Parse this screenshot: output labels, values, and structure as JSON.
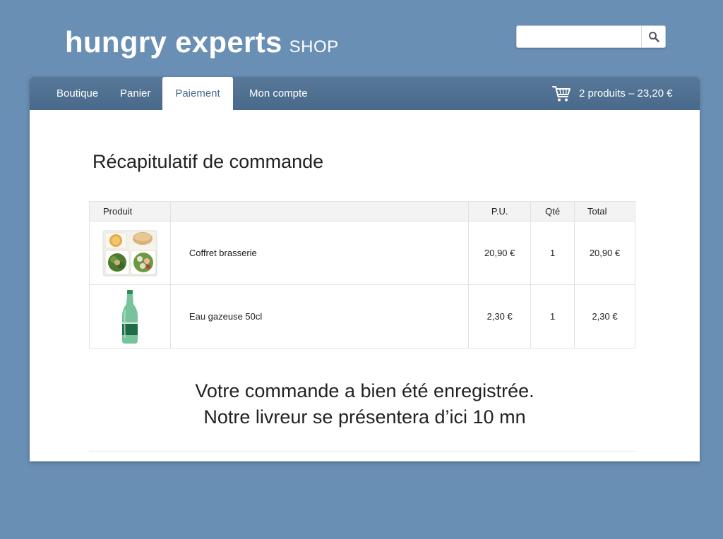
{
  "header": {
    "brand_main": "hungry experts",
    "brand_sub": "SHOP",
    "search": {
      "value": "",
      "placeholder": ""
    }
  },
  "nav": {
    "items": [
      {
        "label": "Boutique",
        "active": false
      },
      {
        "label": "Panier",
        "active": false
      },
      {
        "label": "Paiement",
        "active": true
      },
      {
        "label": "Mon compte",
        "active": false
      }
    ],
    "cart_summary": "2 produits – 23,20 €"
  },
  "main": {
    "title": "Récapitulatif de commande",
    "table": {
      "headers": {
        "product": "Produit",
        "name": "",
        "unit_price": "P.U.",
        "qty": "Qté",
        "total": "Total"
      },
      "rows": [
        {
          "image": "salad-box-thumbnail",
          "name": "Coffret brasserie",
          "unit_price": "20,90 €",
          "qty": "1",
          "total": "20,90 €"
        },
        {
          "image": "water-bottle-thumbnail",
          "name": "Eau gazeuse 50cl",
          "unit_price": "2,30 €",
          "qty": "1",
          "total": "2,30 €"
        }
      ]
    },
    "confirmation": {
      "line1": "Votre commande a bien été enregistrée.",
      "line2": "Notre livreur se présentera d’ici 10 mn"
    }
  },
  "colors": {
    "background": "#6a8fb4",
    "navbar": "#4f7091",
    "active_tab_text": "#4a6b8c",
    "panel": "#ffffff"
  }
}
